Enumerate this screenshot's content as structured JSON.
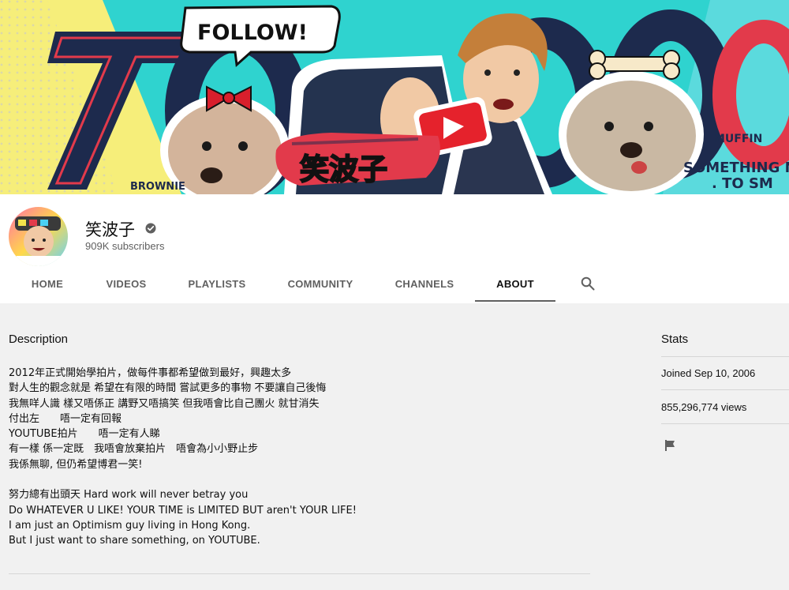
{
  "banner": {
    "follow_text": "FOLLOW!",
    "big_number": "70000",
    "logo_text": "笑波子",
    "left_dog_name": "BROWNIE",
    "right_dog_name": "MUFFIN",
    "tagline_1": "SOMETHING N",
    "tagline_2": ". TO SM"
  },
  "channel": {
    "name": "笑波子",
    "subscribers": "909K subscribers"
  },
  "tabs": [
    {
      "label": "HOME"
    },
    {
      "label": "VIDEOS"
    },
    {
      "label": "PLAYLISTS"
    },
    {
      "label": "COMMUNITY"
    },
    {
      "label": "CHANNELS"
    },
    {
      "label": "ABOUT"
    }
  ],
  "about": {
    "description_heading": "Description",
    "description": "2012年正式開始學拍片，做每件事都希望做到最好，興趣太多\n對人生的觀念就是 希望在有限的時間 嘗試更多的事物 不要讓自己後悔\n我無咩人識 樣又唔係正 講野又唔搞笑 但我唔會比自己團火 就甘消失\n付出左　　唔一定有回報\nYOUTUBE拍片　　唔一定有人睇\n有一樣 係一定既　我唔會放棄拍片　唔會為小小野止步\n我係無聊, 但仍希望博君一笑!\n\n努力總有出頭天 Hard work will never betray you\nDo WHATEVER U LIKE! YOUR TIME is LIMITED BUT aren't YOUR LIFE!\nI am just an Optimism guy living in Hong Kong.\nBut I just want to share something, on YOUTUBE.",
    "stats_heading": "Stats",
    "joined": "Joined Sep 10, 2006",
    "views": "855,296,774 views"
  },
  "colors": {
    "banner_teal": "#2fd3cf",
    "banner_yellow": "#f6ee7a",
    "banner_navy": "#1d2a4d",
    "banner_red": "#e23a4b",
    "youtube_red": "#e5222c"
  },
  "icons": {
    "verified": "verified-check-icon",
    "search": "search-icon",
    "flag": "flag-icon",
    "play": "play-button-icon"
  }
}
